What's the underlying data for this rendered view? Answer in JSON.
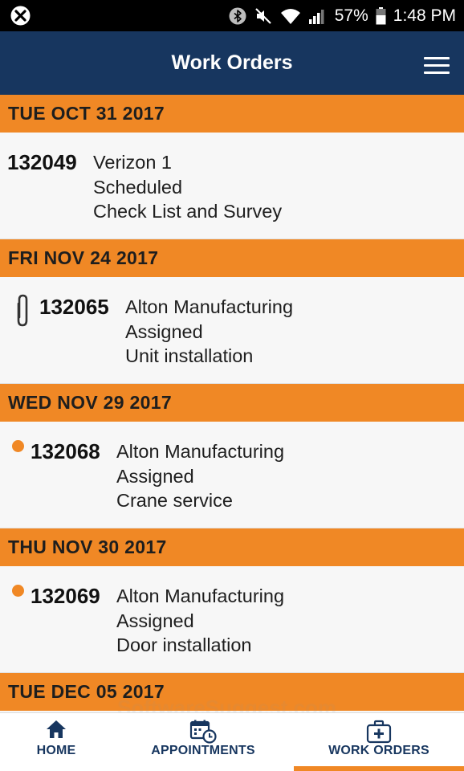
{
  "status_bar": {
    "battery": "57%",
    "time": "1:48 PM"
  },
  "header": {
    "title": "Work Orders"
  },
  "groups": [
    {
      "date": "TUE OCT 31 2017",
      "orders": [
        {
          "number": "132049",
          "customer": "Verizon 1",
          "status": "Scheduled",
          "description": "Check List and Survey",
          "indicator": "none"
        }
      ]
    },
    {
      "date": "FRI NOV 24 2017",
      "orders": [
        {
          "number": "132065",
          "customer": "Alton Manufacturing",
          "status": "Assigned",
          "description": "Unit installation",
          "indicator": "paperclip-icon"
        }
      ]
    },
    {
      "date": "WED NOV 29 2017",
      "orders": [
        {
          "number": "132068",
          "customer": "Alton Manufacturing",
          "status": "Assigned",
          "description": "Crane service",
          "indicator": "orange-dot"
        }
      ]
    },
    {
      "date": "THU NOV 30 2017",
      "orders": [
        {
          "number": "132069",
          "customer": "Alton Manufacturing",
          "status": "Assigned",
          "description": "Door installation",
          "indicator": "orange-dot"
        }
      ]
    },
    {
      "date": "TUE DEC 05 2017",
      "orders": []
    }
  ],
  "bottom_nav": {
    "items": [
      {
        "label": "HOME",
        "icon": "home-icon"
      },
      {
        "label": "APPOINTMENTS",
        "icon": "calendar-clock-icon"
      },
      {
        "label": "WORK ORDERS",
        "icon": "medical-kit-icon"
      }
    ],
    "active": "WORK ORDERS"
  },
  "watermark": "SoftwareSuggest.com",
  "colors": {
    "header_bg": "#17365f",
    "accent_orange": "#f08825",
    "list_bg": "#f7f7f7",
    "status_bar_bg": "#000000",
    "nav_label": "#17365f"
  }
}
